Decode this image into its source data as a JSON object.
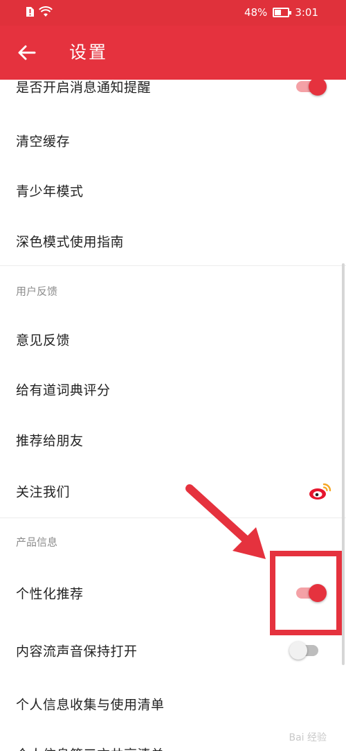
{
  "status_bar": {
    "battery_text": "48%",
    "battery_level": 0.48,
    "time": "3:01"
  },
  "toolbar": {
    "title": "设置"
  },
  "items": {
    "notification": "是否开启消息通知提醒",
    "clear_cache": "清空缓存",
    "teen_mode": "青少年模式",
    "dark_mode_guide": "深色模式使用指南",
    "feedback": "意见反馈",
    "rate_app": "给有道词典评分",
    "recommend_friends": "推荐给朋友",
    "follow_us": "关注我们",
    "personalized": "个性化推荐",
    "stream_sound": "内容流声音保持打开",
    "personal_info_list": "个人信息收集与使用清单",
    "third_party_list": "个人信息第三方共享清单"
  },
  "sections": {
    "user_feedback": "用户反馈",
    "product_info": "产品信息"
  },
  "toggles": {
    "notification": true,
    "personalized": true,
    "stream_sound": false
  },
  "watermark": "Bai 经验",
  "colors": {
    "accent": "#e5323e",
    "status_bar": "#e0313b"
  }
}
